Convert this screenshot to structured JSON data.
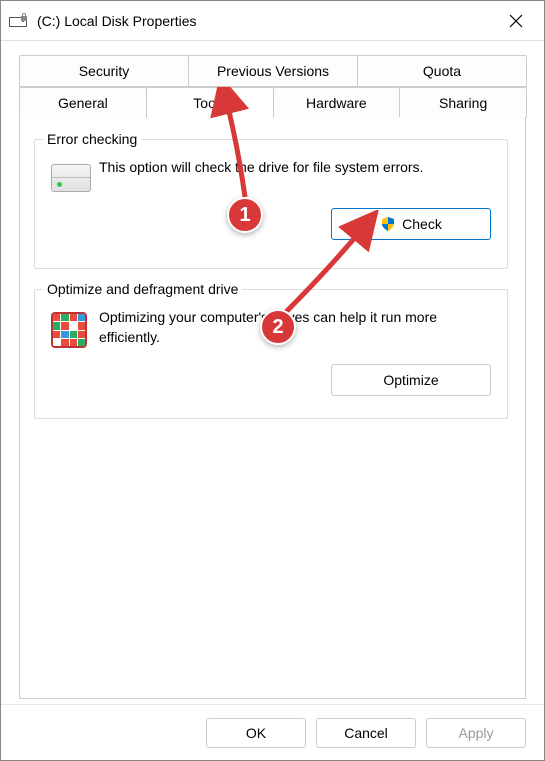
{
  "window": {
    "title": "(C:) Local Disk Properties"
  },
  "tabs": {
    "row1": [
      "Security",
      "Previous Versions",
      "Quota"
    ],
    "row2": [
      "General",
      "Tools",
      "Hardware",
      "Sharing"
    ],
    "active": "Tools"
  },
  "errorChecking": {
    "groupLabel": "Error checking",
    "description": "This option will check the drive for file system errors.",
    "buttonLabel": "Check"
  },
  "optimize": {
    "groupLabel": "Optimize and defragment drive",
    "description": "Optimizing your computer's drives can help it run more efficiently.",
    "buttonLabel": "Optimize"
  },
  "footer": {
    "ok": "OK",
    "cancel": "Cancel",
    "apply": "Apply"
  },
  "annotations": {
    "step1": "1",
    "step2": "2"
  }
}
